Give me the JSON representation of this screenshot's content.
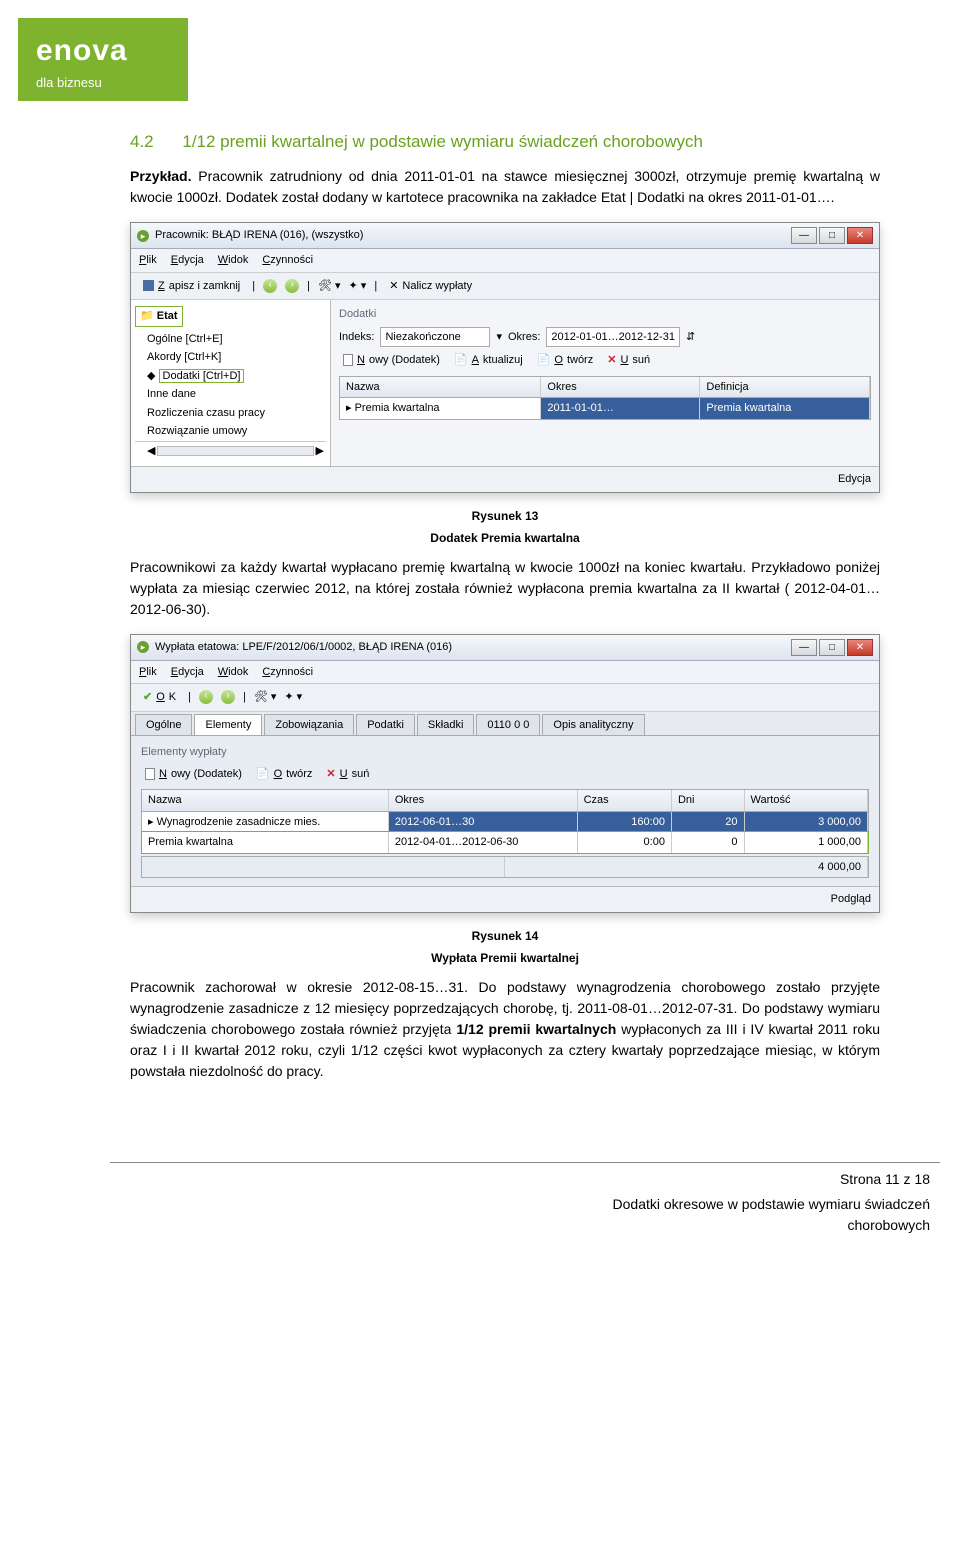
{
  "logo": {
    "brand": "enova",
    "sub": "dla biznesu"
  },
  "heading": {
    "num": "4.2",
    "title": "1/12 premii kwartalnej w podstawie wymiaru świadczeń chorobowych"
  },
  "para1_label": "Przykład.",
  "para1_rest": " Pracownik zatrudniony od dnia 2011-01-01 na stawce miesięcznej 3000zł, otrzymuje premię kwartalną w kwocie 1000zł. Dodatek został dodany w kartotece pracownika na zakładce Etat | Dodatki na okres 2011-01-01….",
  "win1": {
    "title": "Pracownik: BŁĄD IRENA (016), (wszystko)",
    "menu": {
      "m1": "Plik",
      "m2": "Edycja",
      "m3": "Widok",
      "m4": "Czynności"
    },
    "toolbar": {
      "save": "Zapisz i zamknij",
      "nalicz": "Nalicz wypłaty"
    },
    "tree": {
      "root": "Etat",
      "i1": "Ogólne [Ctrl+E]",
      "i2": "Akordy [Ctrl+K]",
      "i3": "Dodatki [Ctrl+D]",
      "i4": "Inne dane",
      "i5": "Rozliczenia czasu pracy",
      "i6": "Rozwiązanie umowy"
    },
    "panel_label": "Dodatki",
    "filter": {
      "indeks_lbl": "Indeks:",
      "indeks_val": "Niezakończone",
      "okres_lbl": "Okres:",
      "okres_val": "2012-01-01…2012-12-31"
    },
    "btns": {
      "nowy": "Nowy (Dodatek)",
      "akt": "Aktualizuj",
      "otw": "Otwórz",
      "usun": "Usuń"
    },
    "thead": {
      "c1": "Nazwa",
      "c2": "Okres",
      "c3": "Definicja"
    },
    "row": {
      "c1": "Premia kwartalna",
      "c2": "2011-01-01…",
      "c3": "Premia kwartalna"
    },
    "status": "Edycja"
  },
  "fig1": {
    "cap": "Rysunek 13",
    "sub": "Dodatek Premia kwartalna"
  },
  "para2": "Pracownikowi za każdy kwartał wypłacano premię kwartalną w kwocie 1000zł na koniec kwartału. Przykładowo poniżej wypłata za miesiąc czerwiec 2012, na której została również wypłacona premia kwartalna za II kwartał ( 2012-04-01…2012-06-30).",
  "win2": {
    "title": "Wypłata etatowa: LPE/F/2012/06/1/0002, BŁĄD IRENA (016)",
    "menu": {
      "m1": "Plik",
      "m2": "Edycja",
      "m3": "Widok",
      "m4": "Czynności"
    },
    "toolbar": {
      "ok": "OK"
    },
    "tabs": {
      "t1": "Ogólne",
      "t2": "Elementy",
      "t3": "Zobowiązania",
      "t4": "Podatki",
      "t5": "Składki",
      "t6": "0110 0 0",
      "t7": "Opis analityczny"
    },
    "section": "Elementy wypłaty",
    "btns": {
      "nowy": "Nowy (Dodatek)",
      "otw": "Otwórz",
      "usun": "Usuń"
    },
    "thead": {
      "c1": "Nazwa",
      "c2": "Okres",
      "c3": "Czas",
      "c4": "Dni",
      "c5": "Wartość"
    },
    "rows": [
      {
        "c1": "Wynagrodzenie zasadnicze mies.",
        "c2": "2012-06-01…30",
        "c3": "160:00",
        "c4": "20",
        "c5": "3 000,00"
      },
      {
        "c1": "Premia kwartalna",
        "c2": "2012-04-01…2012-06-30",
        "c3": "0:00",
        "c4": "0",
        "c5": "1 000,00"
      }
    ],
    "total": "4 000,00",
    "status": "Podgląd"
  },
  "fig2": {
    "cap": "Rysunek 14",
    "sub": "Wypłata Premii kwartalnej"
  },
  "para3a": "Pracownik zachorował w okresie 2012-08-15…31. Do podstawy wynagrodzenia chorobowego zostało przyjęte wynagrodzenie zasadnicze z 12 miesięcy poprzedzających chorobę, tj. 2011-08-01…2012-07-31. Do podstawy wymiaru świadczenia chorobowego została również przyjęta ",
  "para3b": "1/12 premii kwartalnych",
  "para3c": " wypłaconych za III i IV kwartał 2011 roku oraz I i II kwartał 2012 roku, czyli 1/12 części kwot wypłaconych za cztery kwartały poprzedzające miesiąc, w którym powstała niezdolność do pracy.",
  "footer": {
    "page": "Strona 11 z 18",
    "line1": "Dodatki okresowe w podstawie wymiaru świadczeń",
    "line2": "chorobowych"
  }
}
